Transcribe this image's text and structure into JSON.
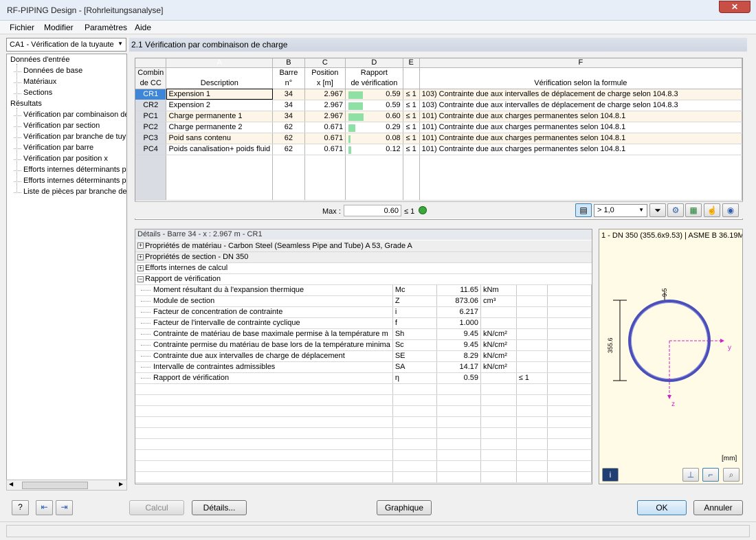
{
  "window": {
    "title": "RF-PIPING Design - [Rohrleitungsanalyse]"
  },
  "menu": [
    "Fichier",
    "Modifier",
    "Paramètres",
    "Aide"
  ],
  "case_select": "CA1 - Vérification de la tuyaute",
  "nav": {
    "input_group": "Données d'entrée",
    "input_items": [
      "Données de base",
      "Matériaux",
      "Sections"
    ],
    "results_group": "Résultats",
    "results_items": [
      "Vérification par combinaison de",
      "Vérification par section",
      "Vérification par branche de tuy",
      "Vérification par barre",
      "Vérification par position x",
      "Efforts internes déterminants p",
      "Efforts internes déterminants p",
      "Liste de pièces par branche de"
    ]
  },
  "section_title": "2.1 Vérification par combinaison de charge",
  "table": {
    "letters": [
      "",
      "A",
      "B",
      "C",
      "D",
      "E",
      "F"
    ],
    "head1": [
      "Combin",
      "",
      "Barre",
      "Position",
      "Rapport",
      "",
      ""
    ],
    "head2": [
      "de CC",
      "Description",
      "n°",
      "x [m]",
      "de vérification",
      "",
      "Vérification selon la formule"
    ],
    "rows": [
      {
        "cc": "CR1",
        "desc": "Expension 1",
        "bar": "34",
        "x": "2.967",
        "ratio": 0.59,
        "ratio_txt": "0.59",
        "le": "≤ 1",
        "formula": "103) Contrainte due aux intervalles de déplacement de charge selon 104.8.3"
      },
      {
        "cc": "CR2",
        "desc": "Expension 2",
        "bar": "34",
        "x": "2.967",
        "ratio": 0.59,
        "ratio_txt": "0.59",
        "le": "≤ 1",
        "formula": "103) Contrainte due aux intervalles de déplacement de charge selon 104.8.3"
      },
      {
        "cc": "PC1",
        "desc": "Charge permanente 1",
        "bar": "34",
        "x": "2.967",
        "ratio": 0.6,
        "ratio_txt": "0.60",
        "le": "≤ 1",
        "formula": "101) Contrainte due aux charges permanentes selon 104.8.1"
      },
      {
        "cc": "PC2",
        "desc": "Charge permanente 2",
        "bar": "62",
        "x": "0.671",
        "ratio": 0.29,
        "ratio_txt": "0.29",
        "le": "≤ 1",
        "formula": "101) Contrainte due aux charges permanentes selon 104.8.1"
      },
      {
        "cc": "PC3",
        "desc": "Poid sans contenu",
        "bar": "62",
        "x": "0.671",
        "ratio": 0.08,
        "ratio_txt": "0.08",
        "le": "≤ 1",
        "formula": "101) Contrainte due aux charges permanentes selon 104.8.1"
      },
      {
        "cc": "PC4",
        "desc": "Poids canalisation+ poids fluid",
        "bar": "62",
        "x": "0.671",
        "ratio": 0.12,
        "ratio_txt": "0.12",
        "le": "≤ 1",
        "formula": "101) Contrainte due aux charges permanentes selon 104.8.1"
      }
    ],
    "max_label": "Max :",
    "max_value": "0.60",
    "max_le": "≤ 1",
    "filter_value": "> 1,0"
  },
  "details": {
    "header": "Détails - Barre 34 - x : 2.967 m - CR1",
    "groups": [
      "Propriétés de matériau - Carbon Steel (Seamless Pipe and Tube) A 53, Grade A",
      "Propriétés de section  -  DN 350",
      "Efforts internes de calcul",
      "Rapport de vérification"
    ],
    "rows": [
      {
        "label": "Moment résultant du à l'expansion thermique",
        "sym": "Mc",
        "val": "11.65",
        "unit": "kNm",
        "le": ""
      },
      {
        "label": "Module de section",
        "sym": "Z",
        "val": "873.06",
        "unit": "cm³",
        "le": ""
      },
      {
        "label": "Facteur de concentration de contrainte",
        "sym": "i",
        "val": "6.217",
        "unit": "",
        "le": ""
      },
      {
        "label": "Facteur de l'intervalle de contrainte cyclique",
        "sym": "f",
        "val": "1.000",
        "unit": "",
        "le": ""
      },
      {
        "label": "Contrainte de matériau de base maximale permise à la température m",
        "sym": "Sh",
        "val": "9.45",
        "unit": "kN/cm²",
        "le": ""
      },
      {
        "label": "Contrainte permise du matériau de base lors de la température minima",
        "sym": "Sc",
        "val": "9.45",
        "unit": "kN/cm²",
        "le": ""
      },
      {
        "label": "Contrainte due aux intervalles de charge de déplacement",
        "sym": "SE",
        "val": "8.29",
        "unit": "kN/cm²",
        "le": ""
      },
      {
        "label": "Intervalle de contraintes admissibles",
        "sym": "SA",
        "val": "14.17",
        "unit": "kN/cm²",
        "le": ""
      },
      {
        "label": "Rapport de vérification",
        "sym": "η",
        "val": "0.59",
        "unit": "",
        "le": "≤ 1"
      }
    ]
  },
  "graphic": {
    "header": "1 - DN 350 (355.6x9.53) | ASME B 36.19M",
    "dim_outer": "355.6",
    "dim_wall": "9.5",
    "axis_y": "y",
    "axis_z": "z",
    "unit": "[mm]",
    "colors": {
      "pipe": "#4b4fb8",
      "axis": "#d020c8",
      "dim": "#000000"
    }
  },
  "buttons": {
    "calc": "Calcul",
    "details": "Détails...",
    "graphic": "Graphique",
    "ok": "OK",
    "cancel": "Annuler"
  }
}
